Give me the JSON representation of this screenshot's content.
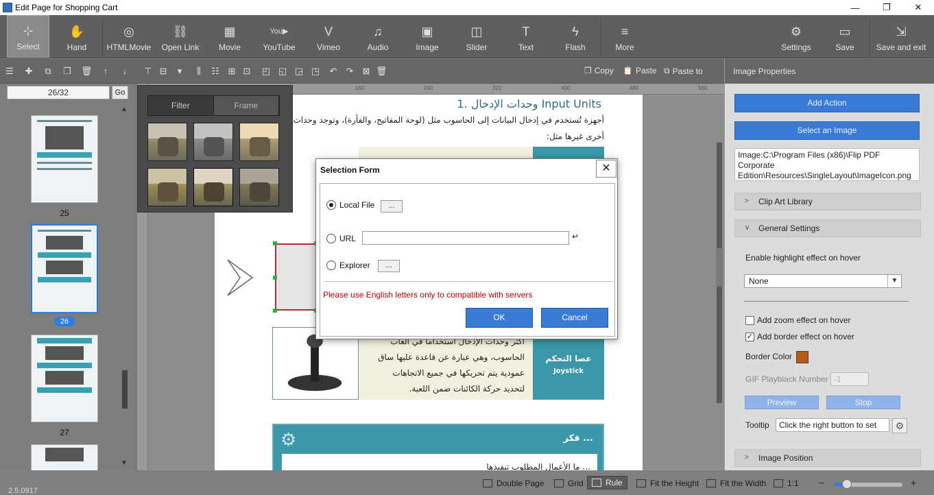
{
  "window": {
    "title": "Edit Page for Shopping Cart",
    "controls": [
      "—",
      "❐",
      "✕"
    ]
  },
  "ribbon": {
    "buttons": [
      {
        "label": "Select",
        "icon": "select-icon"
      },
      {
        "label": "Hand",
        "icon": "hand-icon"
      },
      {
        "label": "HTMLMovie",
        "icon": "film-reel-icon"
      },
      {
        "label": "Open Link",
        "icon": "link-icon"
      },
      {
        "label": "Movie",
        "icon": "movie-icon"
      },
      {
        "label": "YouTube",
        "icon": "youtube-icon"
      },
      {
        "label": "Vimeo",
        "icon": "vimeo-icon"
      },
      {
        "label": "Audio",
        "icon": "music-note-icon"
      },
      {
        "label": "Image",
        "icon": "image-icon"
      },
      {
        "label": "Slider",
        "icon": "slider-icon"
      },
      {
        "label": "Text",
        "icon": "text-icon"
      },
      {
        "label": "Flash",
        "icon": "flash-icon"
      },
      {
        "label": "More",
        "icon": "more-icon"
      }
    ],
    "right_buttons": [
      {
        "label": "Settings",
        "icon": "gear-icon"
      },
      {
        "label": "Save",
        "icon": "save-icon"
      },
      {
        "label": "Save and exit",
        "icon": "save-exit-icon"
      }
    ]
  },
  "toolbar2": {
    "copy": "Copy",
    "paste": "Paste",
    "paste_to": "Paste to"
  },
  "left_panel": {
    "page_indicator": "26/32",
    "go": "Go",
    "thumbs": [
      {
        "label": "25"
      },
      {
        "label": "26",
        "selected": true
      },
      {
        "label": "27"
      }
    ],
    "version": "2.5.0917"
  },
  "filter_popup": {
    "tabs": [
      "Filter",
      "Frame"
    ]
  },
  "page_content": {
    "heading": "1. وحدات الإدخال Input Units",
    "line1": "أجهزة تُستخدم في إدخال البيانات إلى الحاسوب مثل (لوحة المفاتيح، والفأرة)، وتوجد وحدات إدخال",
    "line2": "أخرى غيرها مثل:",
    "joystick_text1": "أكثر وحدات الإدخال استخداما في ألعاب",
    "joystick_text2": "الحاسوب، وهي عبارة عن قاعدة عليها ساق",
    "joystick_text3": "عمودية يتم تحريكها في جميع الاتجاهات",
    "joystick_text4": "لتحديد حركة الكائنات ضمن اللعبة.",
    "joystick_label_ar": "عصا التحكم",
    "joystick_label_en": "Joystick",
    "think_label": "فكر ...",
    "think_text": "ما الأعمال المطلوب تنفيذها ..."
  },
  "rulers": {
    "top": [
      "160",
      "240",
      "320",
      "400",
      "480",
      "560"
    ],
    "left": [
      "1",
      "6",
      "0",
      "2",
      "4",
      "0",
      "3",
      "2",
      "0",
      "4",
      "0",
      "0",
      "4",
      "8",
      "0"
    ]
  },
  "right_panel": {
    "header": "Image Properties",
    "add_action": "Add Action",
    "select_image": "Select an Image",
    "path": "Image:C:\\Program Files (x86)\\Flip PDF Corporate Edition\\Resources\\SingleLayout\\ImageIcon.png",
    "clip_art": "Clip Art Library",
    "general_settings": "General Settings",
    "highlight_label": "Enable highlight effect on hover",
    "highlight_value": "None",
    "zoom_label": "Add zoom effect on hover",
    "zoom_checked": false,
    "border_label": "Add border effect on hover",
    "border_checked": true,
    "border_color_label": "Border Color",
    "border_color": "#b85a10",
    "gif_label": "GIF Playblack Number",
    "gif_value": "-1",
    "preview": "Preview",
    "stop": "Stop",
    "tooltip_label": "Tooltip",
    "tooltip_value": "Click the right button to set",
    "image_position": "Image Position"
  },
  "statusbar": {
    "double_page": "Double Page",
    "grid": "Grid",
    "rule": "Rule",
    "fit_height": "Fit the Height",
    "fit_width": "Fit the Width",
    "ratio": "1:1",
    "zoom_minus": "−",
    "zoom_plus": "+",
    "zoom_level": 0.12
  },
  "modal": {
    "title": "Selection Form",
    "close": "✕",
    "local_file": "Local File",
    "url": "URL",
    "explorer": "Explorer",
    "dots": "...",
    "enter": "↵",
    "selected_option": "Local File",
    "url_value": "",
    "warning": "Please use English letters only to compatible with servers",
    "ok": "OK",
    "cancel": "Cancel"
  },
  "colors": {
    "accent": "#3a7bd5",
    "teal": "#3a98a8",
    "warning": "#c00000"
  }
}
